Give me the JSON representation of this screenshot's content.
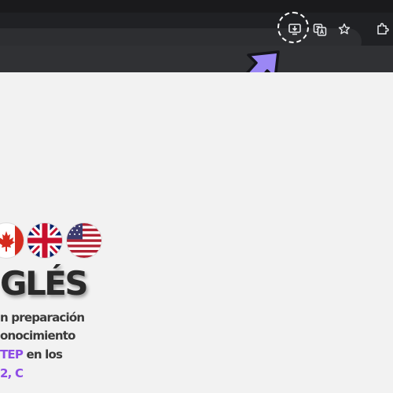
{
  "browser": {
    "toolbar_icons": [
      "install-app-icon",
      "translate-icon",
      "star-icon",
      "extensions-icon"
    ],
    "highlight_color": "#ffffff",
    "arrow_color": "#9b87f5"
  },
  "page": {
    "flags": [
      "canada-flag-icon",
      "uk-flag-icon",
      "usa-flag-icon"
    ],
    "heading": "GLÉS",
    "lines": {
      "l1": "n preparación",
      "l2": "onocimiento",
      "l3_accent": "TEP",
      "l3_rest": " en los",
      "l4_accent": "2, C"
    },
    "accent_color": "#8e4de6"
  }
}
